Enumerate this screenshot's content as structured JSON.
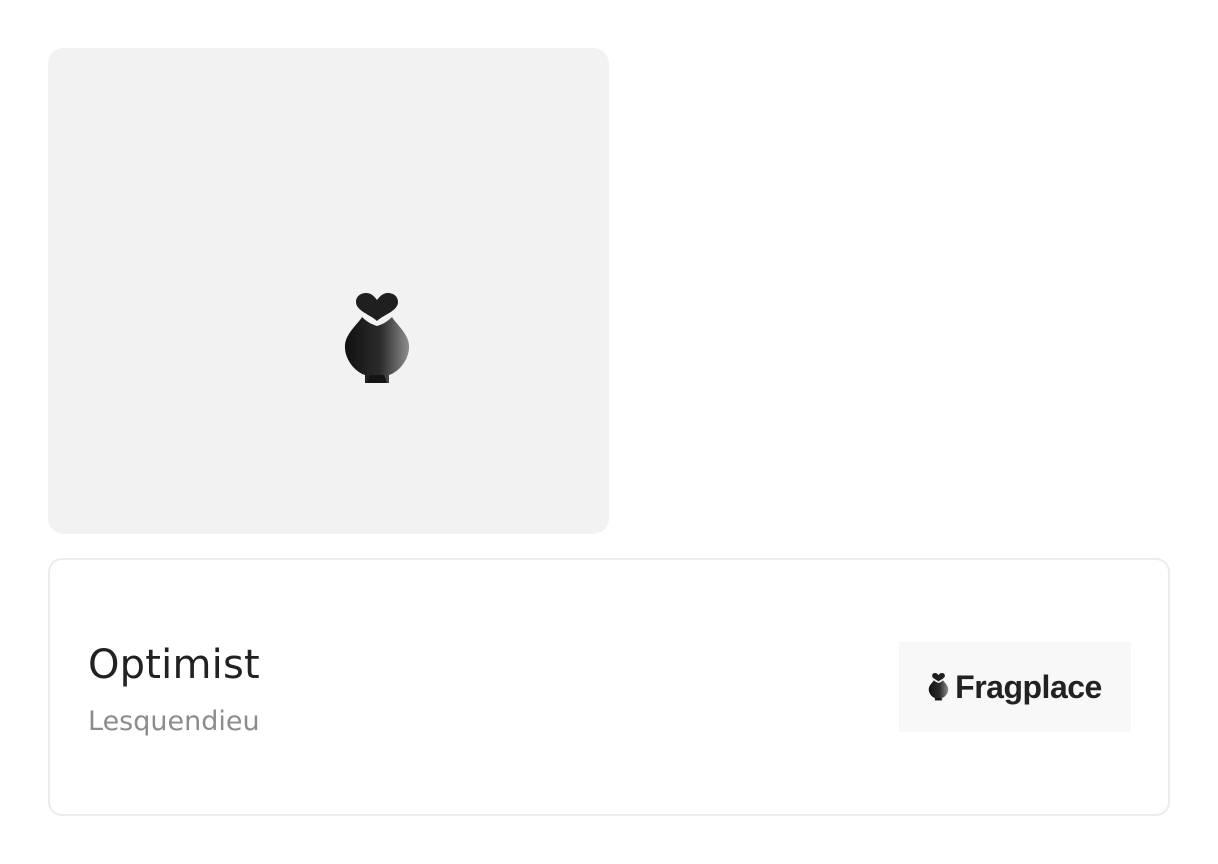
{
  "product": {
    "image_alt": "Fragplace placeholder logo",
    "name": "Optimist",
    "brand": "Lesquendieu"
  },
  "retailer": {
    "name": "Fragplace",
    "icon": "perfume-bottle-heart-icon"
  },
  "colors": {
    "page_background": "#ffffff",
    "image_background": "#f2f2f2",
    "card_border": "#ececec",
    "title_text": "#222222",
    "brand_text": "#8c8c8c",
    "retailer_background": "#f8f8f8"
  }
}
